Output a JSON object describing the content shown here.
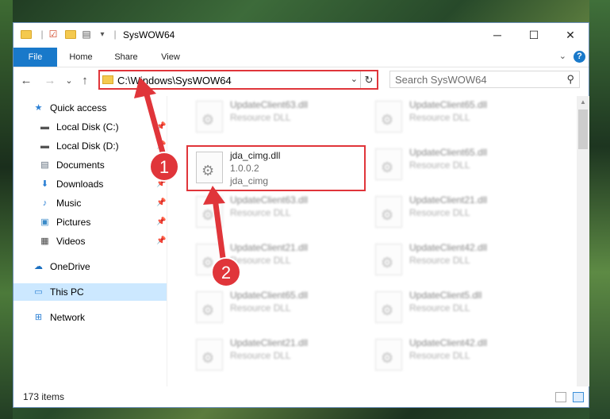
{
  "window": {
    "title": "SysWOW64",
    "minimize_glyph": "─",
    "maximize_glyph": "☐",
    "close_glyph": "✕"
  },
  "ribbon": {
    "tabs": [
      "File",
      "Home",
      "Share",
      "View"
    ],
    "help_glyph": "?",
    "expand_glyph": "⌄"
  },
  "nav": {
    "back_glyph": "←",
    "forward_glyph": "→",
    "recent_glyph": "⌄",
    "up_glyph": "↑",
    "address": "C:\\Windows\\SysWOW64",
    "address_drop_glyph": "⌄",
    "refresh_glyph": "↻",
    "search_placeholder": "Search SysWOW64",
    "search_glyph": "⚲"
  },
  "sidebar": {
    "items": [
      {
        "label": "Quick access",
        "icon": "star-icon",
        "glyph": "★",
        "color": "#2a7fd4"
      },
      {
        "label": "Local Disk (C:)",
        "icon": "drive-icon",
        "glyph": "▬",
        "color": "#555555",
        "pinned": true
      },
      {
        "label": "Local Disk (D:)",
        "icon": "drive-icon",
        "glyph": "▬",
        "color": "#555555",
        "pinned": true
      },
      {
        "label": "Documents",
        "icon": "document-icon",
        "glyph": "▤",
        "color": "#5c6a7a",
        "pinned": true
      },
      {
        "label": "Downloads",
        "icon": "download-icon",
        "glyph": "⬇",
        "color": "#2a7fd4",
        "pinned": true
      },
      {
        "label": "Music",
        "icon": "music-icon",
        "glyph": "♪",
        "color": "#2a7fd4",
        "pinned": true
      },
      {
        "label": "Pictures",
        "icon": "pictures-icon",
        "glyph": "▣",
        "color": "#3a8ac8",
        "pinned": true
      },
      {
        "label": "Videos",
        "icon": "video-icon",
        "glyph": "▦",
        "color": "#444444",
        "pinned": true
      },
      {
        "label": "OneDrive",
        "icon": "cloud-icon",
        "glyph": "☁",
        "color": "#1a6fc0"
      },
      {
        "label": "This PC",
        "icon": "computer-icon",
        "glyph": "▭",
        "color": "#2a7fd4",
        "selected": true
      },
      {
        "label": "Network",
        "icon": "network-icon",
        "glyph": "⊞",
        "color": "#2a7fd4"
      }
    ],
    "pin_glyph": "📌"
  },
  "files": [
    {
      "name": "UpdateClient63.dll",
      "desc": "Resource DLL",
      "blurred": true
    },
    {
      "name": "UpdateClient65.dll",
      "desc": "Resource DLL",
      "blurred": true
    },
    {
      "name": "jda_cimg.dll",
      "desc": "1.0.0.2",
      "extra": "jda_cimg",
      "blurred": false
    },
    {
      "name": "UpdateClient65.dll",
      "desc": "Resource DLL",
      "blurred": true
    },
    {
      "name": "UpdateClient63.dll",
      "desc": "Resource DLL",
      "blurred": true
    },
    {
      "name": "UpdateClient21.dll",
      "desc": "Resource DLL",
      "blurred": true
    },
    {
      "name": "UpdateClient21.dll",
      "desc": "Resource DLL",
      "blurred": true
    },
    {
      "name": "UpdateClient42.dll",
      "desc": "Resource DLL",
      "blurred": true
    },
    {
      "name": "UpdateClient65.dll",
      "desc": "Resource DLL",
      "blurred": true
    },
    {
      "name": "UpdateClient5.dll",
      "desc": "Resource DLL",
      "blurred": true
    },
    {
      "name": "UpdateClient21.dll",
      "desc": "Resource DLL",
      "blurred": true
    },
    {
      "name": "UpdateClient42.dll",
      "desc": "Resource DLL",
      "blurred": true
    }
  ],
  "status": {
    "item_count": "173 items"
  },
  "annotations": {
    "marker_1": "1",
    "marker_2": "2",
    "color": "#e0353a"
  }
}
